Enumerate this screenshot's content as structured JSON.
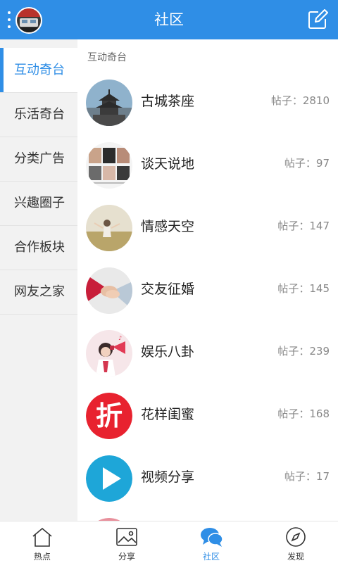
{
  "header": {
    "title": "社区",
    "menu_icon": "more-vertical-icon",
    "compose_icon": "edit-icon"
  },
  "sidebar": {
    "items": [
      {
        "label": "互动奇台",
        "active": true
      },
      {
        "label": "乐活奇台",
        "active": false
      },
      {
        "label": "分类广告",
        "active": false
      },
      {
        "label": "兴趣圈子",
        "active": false
      },
      {
        "label": "合作板块",
        "active": false
      },
      {
        "label": "网友之家",
        "active": false
      }
    ]
  },
  "content": {
    "section_title": "互动奇台",
    "forums": [
      {
        "name": "古城茶座",
        "posts": "帖子：2810",
        "icon": "pagoda-photo"
      },
      {
        "name": "谈天说地",
        "posts": "帖子：97",
        "icon": "magazine-photo"
      },
      {
        "name": "情感天空",
        "posts": "帖子：147",
        "icon": "girl-field-photo"
      },
      {
        "name": "交友征婚",
        "posts": "帖子：145",
        "icon": "holding-hands-photo"
      },
      {
        "name": "娱乐八卦",
        "posts": "帖子：239",
        "icon": "megaphone-girl-photo"
      },
      {
        "name": "花样闺蜜",
        "posts": "帖子：168",
        "icon": "discount-zhe-icon"
      },
      {
        "name": "视频分享",
        "posts": "帖子：17",
        "icon": "play-icon"
      }
    ]
  },
  "tabbar": {
    "tabs": [
      {
        "label": "热点",
        "icon": "home-icon",
        "active": false
      },
      {
        "label": "分享",
        "icon": "image-icon",
        "active": false
      },
      {
        "label": "社区",
        "icon": "chat-bubbles-icon",
        "active": true
      },
      {
        "label": "发现",
        "icon": "compass-icon",
        "active": false
      }
    ]
  },
  "colors": {
    "primary": "#2f8ee6",
    "sidebar_bg": "#f2f2f2",
    "text": "#222222",
    "muted": "#888888"
  }
}
